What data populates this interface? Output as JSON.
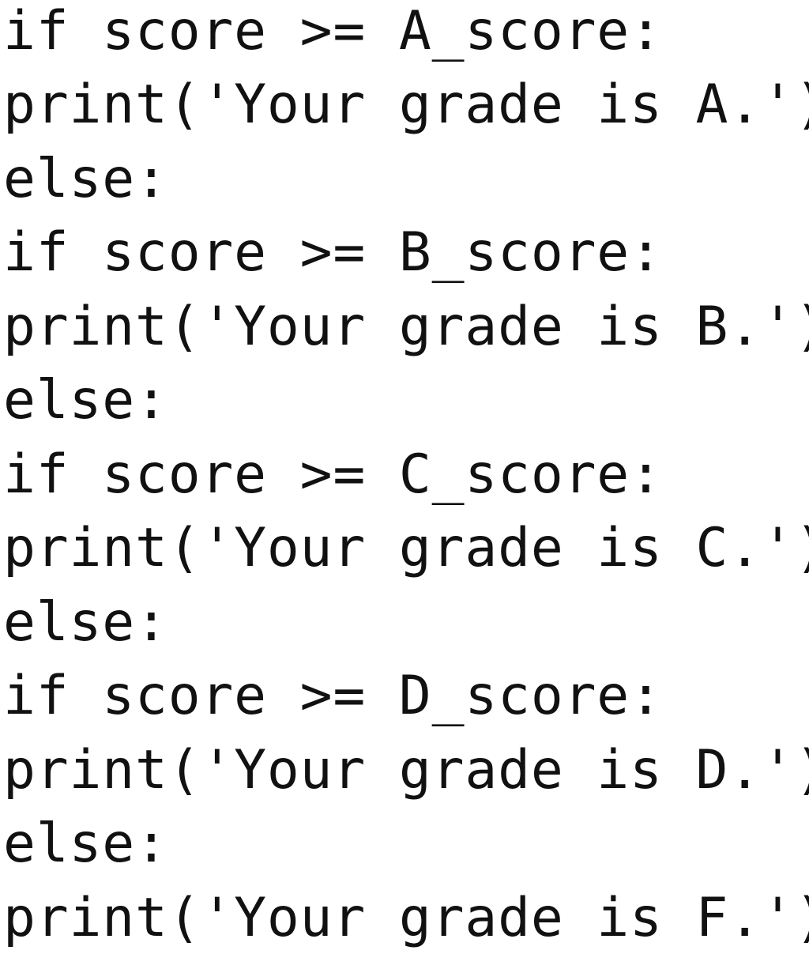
{
  "code": {
    "lines": [
      "if score >= A_score:",
      "print('Your grade is A.')",
      "else:",
      "if score >= B_score:",
      "print('Your grade is B.')",
      "else:",
      "if score >= C_score:",
      "print('Your grade is C.')",
      "else:",
      "if score >= D_score:",
      "print('Your grade is D.')",
      "else:",
      "print('Your grade is F.')"
    ]
  }
}
